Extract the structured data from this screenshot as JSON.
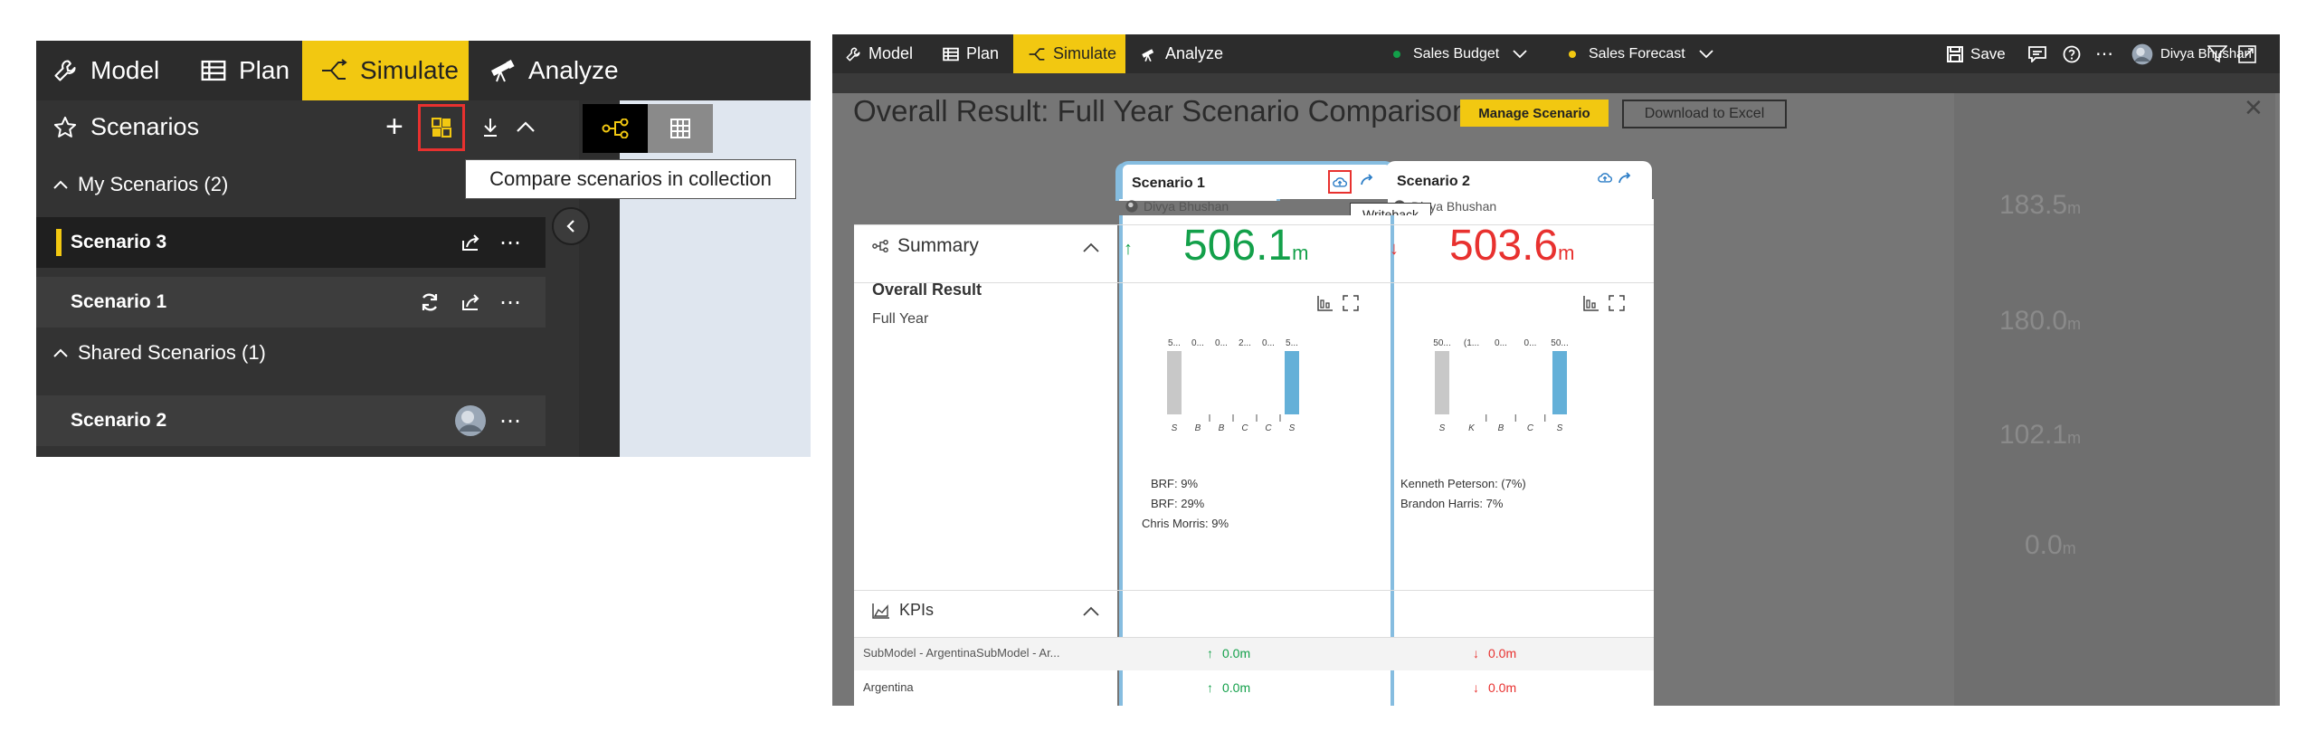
{
  "left": {
    "nav": [
      {
        "label": "Model",
        "icon": "wrench-icon"
      },
      {
        "label": "Plan",
        "icon": "table-icon"
      },
      {
        "label": "Simulate",
        "icon": "simulate-icon",
        "active": true
      },
      {
        "label": "Analyze",
        "icon": "telescope-icon"
      }
    ],
    "scenarios_title": "Scenarios",
    "tooltip": "Compare scenarios in collection",
    "my_section": "My Scenarios (2)",
    "shared_section": "Shared Scenarios (1)",
    "my_items": [
      {
        "label": "Scenario 3",
        "selected": true
      },
      {
        "label": "Scenario 1",
        "selected": false
      }
    ],
    "shared_items": [
      {
        "label": "Scenario 2"
      }
    ]
  },
  "right": {
    "nav": [
      {
        "label": "Model",
        "icon": "wrench-icon"
      },
      {
        "label": "Plan",
        "icon": "table-icon"
      },
      {
        "label": "Simulate",
        "icon": "simulate-icon",
        "active": true
      },
      {
        "label": "Analyze",
        "icon": "telescope-icon"
      }
    ],
    "budget_label": "Sales Budget",
    "forecast_label": "Sales Forecast",
    "save_label": "Save",
    "user_name": "Divya Bhushan",
    "dim_values": [
      "183.5",
      "180.0",
      "102.1",
      "0.0"
    ],
    "dim_unit": "m",
    "title": "Overall Result: Full Year Scenario Comparison",
    "manage_label": "Manage Scenario",
    "download_label": "Download to Excel",
    "summary_label": "Summary",
    "overall_result_label": "Overall Result",
    "full_year_label": "Full Year",
    "kpis_label": "KPIs",
    "kpi_rows": [
      "SubModel - ArgentinaSubModel - Ar...",
      "Argentina"
    ],
    "writeback_tooltip": "Writeback",
    "colors": {
      "green": "#13a04a",
      "red": "#e8312f",
      "accent": "#f2c811",
      "selected_border": "#86bde0",
      "bar_gray": "#c8c8c8",
      "bar_blue": "#64b0d8"
    },
    "scenarios": [
      {
        "name": "Scenario 1",
        "owner": "Divya Bhushan",
        "direction": "up",
        "value": "506.1",
        "unit": "m",
        "chart_top_labels": [
          "5...",
          "0...",
          "0...",
          "2...",
          "0...",
          "5..."
        ],
        "chart_bottom_labels": [
          "S",
          "B",
          "B",
          "C",
          "C",
          "S"
        ],
        "drivers": [
          "BRF: 9%",
          "BRF: 29%",
          "Chris Morris: 9%"
        ],
        "kpi_values": [
          "0.0m",
          "0.0m"
        ],
        "kpi_direction": "up"
      },
      {
        "name": "Scenario 2",
        "owner": "Divya Bhushan",
        "direction": "down",
        "value": "503.6",
        "unit": "m",
        "chart_top_labels": [
          "50...",
          "(1...",
          "0...",
          "0...",
          "50..."
        ],
        "chart_bottom_labels": [
          "S",
          "K",
          "B",
          "C",
          "S"
        ],
        "drivers": [
          "Kenneth Peterson: (7%)",
          "Brandon Harris: 7%"
        ],
        "kpi_values": [
          "0.0m",
          "0.0m"
        ],
        "kpi_direction": "down"
      }
    ]
  }
}
